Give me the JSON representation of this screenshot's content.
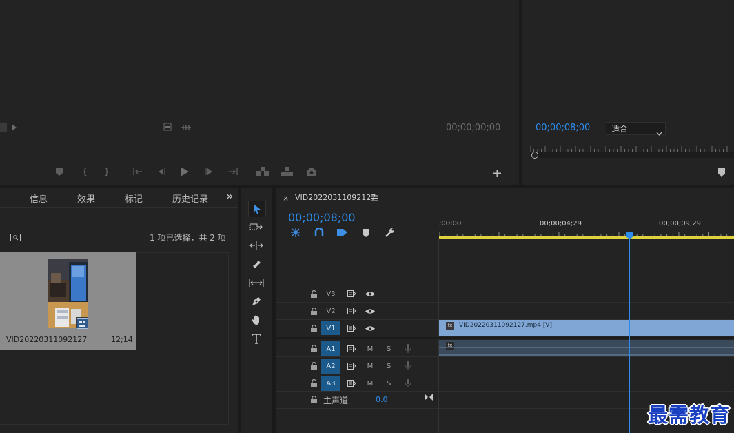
{
  "source_monitor": {
    "timecode": "00;00;00;00"
  },
  "program_monitor": {
    "timecode": "00;00;08;00",
    "zoom_select": "适合"
  },
  "project_panel": {
    "tabs": [
      "信息",
      "效果",
      "标记",
      "历史记录"
    ],
    "overflow": "»",
    "status": "1 项已选择，共 2 项",
    "clip": {
      "name": "VID20220311092127",
      "duration": "12;14"
    }
  },
  "timeline": {
    "sequence_name": "VID20220311092127",
    "timecode": "00;00;08;00",
    "ruler": [
      ";00;00",
      "00;00;04;29",
      "00;00;09;29"
    ],
    "video_tracks": [
      {
        "label": "V3",
        "selected": false
      },
      {
        "label": "V2",
        "selected": false
      },
      {
        "label": "V1",
        "selected": true
      }
    ],
    "audio_tracks": [
      {
        "label": "A1",
        "m": "M",
        "s": "S"
      },
      {
        "label": "A2",
        "m": "M",
        "s": "S"
      },
      {
        "label": "A3",
        "m": "M",
        "s": "S"
      }
    ],
    "master": {
      "label": "主声道",
      "value": "0.0"
    },
    "video_clip": {
      "name": "VID20220311092127.mp4 [V]",
      "badge": "fx"
    },
    "audio_clip": {
      "badge": "fx"
    }
  },
  "watermark": "最需教育",
  "colors": {
    "timecode_blue": "#2d8ceb",
    "playhead_blue": "#2d8ceb",
    "video_clip": "#7fa6d4",
    "track_selected": "#1d5a8c",
    "work_area": "#e0d23a"
  }
}
